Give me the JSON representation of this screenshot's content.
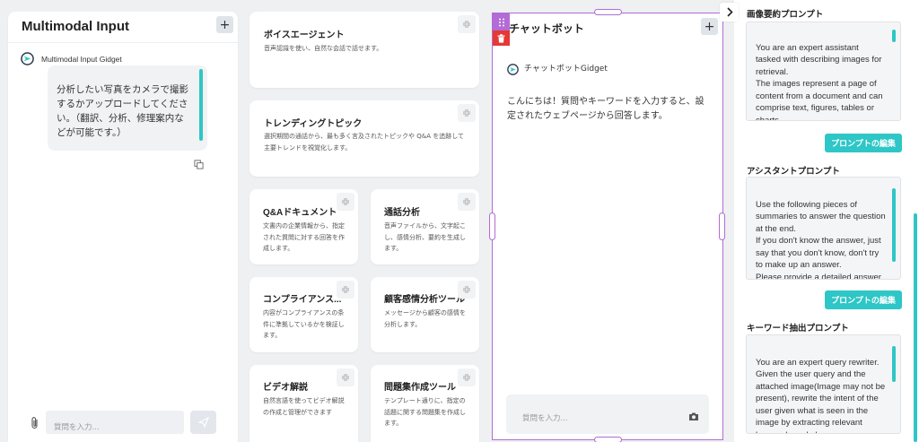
{
  "multimodal": {
    "title": "Multimodal Input",
    "add_label": "+",
    "gidget_name": "Multimodal Input Gidget",
    "message": "分析したい写真をカメラで撮影するかアップロードしてください。（翻訳、分析、修理案内などが可能です。）",
    "input_placeholder": "質問を入力..."
  },
  "gidgets": [
    {
      "title": "ボイスエージェント",
      "desc": "音声認識を使い、自然な会話で話せます。"
    },
    {
      "title": "トレンディングトピック",
      "desc": "選択期間の通話から、最も多く言及されたトピックや Q&A を追跡して主要トレンドを視覚化します。"
    },
    {
      "title": "Q&Aドキュメント",
      "desc": "文書内の企業情報から、指定された質問に対する回答を作成します。"
    },
    {
      "title": "通話分析",
      "desc": "音声ファイルから、文字起こし、感情分析、要約を生成します。"
    },
    {
      "title": "コンプライアンス...",
      "desc": "内容がコンプライアンスの条件に準拠しているかを検証します。"
    },
    {
      "title": "顧客感情分析ツール",
      "desc": "メッセージから顧客の感情を分析します。"
    },
    {
      "title": "ビデオ解説",
      "desc": "自然言語を使ってビデオ解説の作成と管理ができます"
    },
    {
      "title": "問題集作成ツール",
      "desc": "テンプレート通りに、指定の話題に関する問題集を作成します。"
    }
  ],
  "chatbot": {
    "title": "チャットボット",
    "add_label": "+",
    "gidget_name": "チャットボットGidget",
    "message": "こんにちは！質問やキーワードを入力すると、設定されたウェブページから回答します。",
    "input_placeholder": "質問を入力..."
  },
  "prompts": {
    "image_summary": {
      "label": "画像要約プロンプト",
      "text": "You are an expert assistant tasked with describing images for retrieval.\nThe images represent a page of content from a document and can comprise text, figures, tables or charts.",
      "edit_label": "プロンプトの編集"
    },
    "assistant": {
      "label": "アシスタントプロンプト",
      "text": "Use the following pieces of summaries to answer the question at the end.\nIf you don't know the answer, just say that you don't know, don't try to make up an answer.\nPlease provide a detailed answer",
      "edit_label": "プロンプトの編集"
    },
    "keyword": {
      "label": "キーワード抽出プロンプト",
      "text": "You are an expert query rewriter. Given the user query and the attached image(Image may not be present), rewrite the intent of the user given what is seen in the image by extracting relevant keywords and phrases."
    }
  },
  "colors": {
    "accent": "#2ec6c6",
    "selection": "#b36bd6",
    "delete": "#e53935"
  }
}
